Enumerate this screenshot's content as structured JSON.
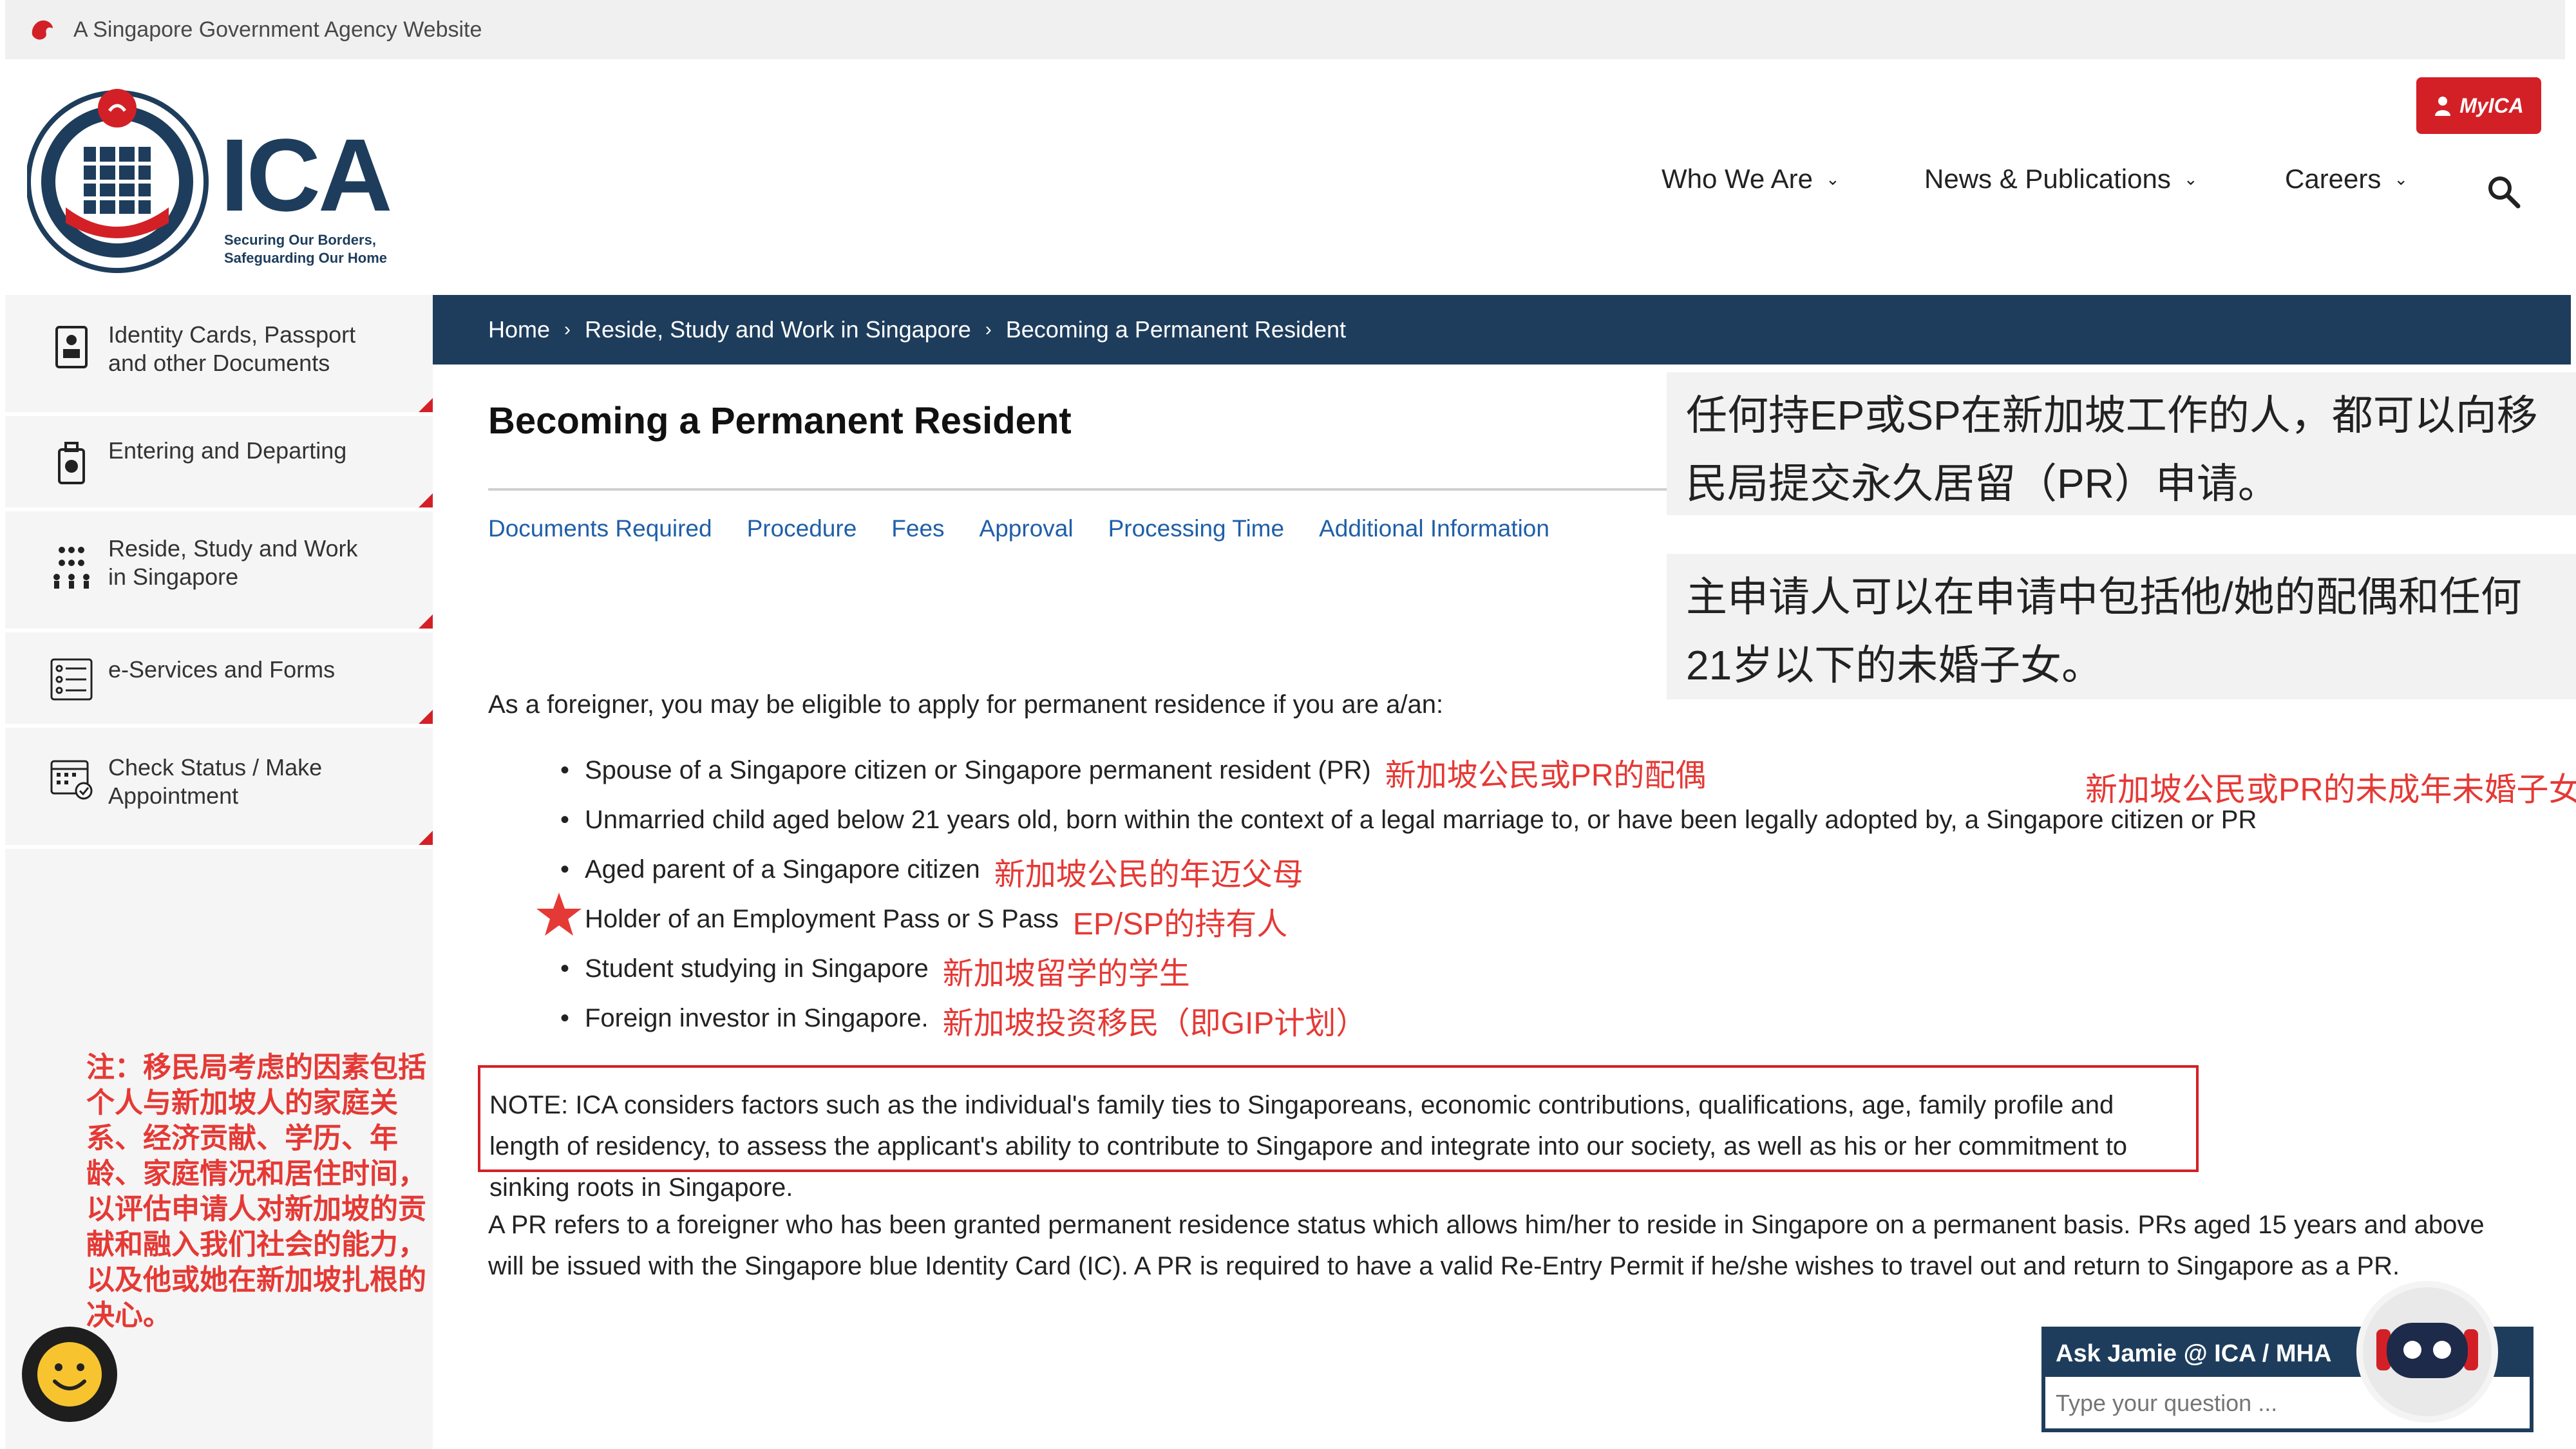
{
  "govbar": {
    "text": "A Singapore Government Agency Website"
  },
  "header": {
    "logo_text": "ICA",
    "logo_tagline_1": "Securing Our Borders,",
    "logo_tagline_2": "Safeguarding Our Home",
    "myica_label": "MyICA",
    "nav": [
      {
        "label": "Who We Are"
      },
      {
        "label": "News & Publications"
      },
      {
        "label": "Careers"
      }
    ]
  },
  "sidebar": {
    "items": [
      {
        "label_1": "Identity Cards, Passport",
        "label_2": "and other Documents",
        "icon": "id-card-icon"
      },
      {
        "label_1": "Entering and Departing",
        "label_2": "",
        "icon": "luggage-icon"
      },
      {
        "label_1": "Reside, Study and Work",
        "label_2": "in Singapore",
        "icon": "people-icon"
      },
      {
        "label_1": "e-Services and Forms",
        "label_2": "",
        "icon": "form-list-icon"
      },
      {
        "label_1": "Check Status / Make",
        "label_2": "Appointment",
        "icon": "calendar-check-icon"
      }
    ]
  },
  "breadcrumb": {
    "items": [
      "Home",
      "Reside, Study and Work in Singapore",
      "Becoming a Permanent Resident"
    ]
  },
  "main": {
    "title": "Becoming a Permanent Resident",
    "tabs": [
      "Documents Required",
      "Procedure",
      "Fees",
      "Approval",
      "Processing Time",
      "Additional Information"
    ],
    "intro": "As a foreigner, you may be eligible to apply for permanent residence if you are a/an:",
    "bullets": [
      {
        "text": "Spouse of a Singapore citizen or Singapore permanent resident (PR)",
        "zh": "新加坡公民或PR的配偶"
      },
      {
        "text": "Unmarried child aged below 21 years old, born within the context of a legal marriage to, or have been legally adopted by, a Singapore citizen or PR",
        "zh": ""
      },
      {
        "text": "Aged parent of a Singapore citizen",
        "zh": "新加坡公民的年迈父母"
      },
      {
        "text": "Holder of an Employment Pass or S Pass",
        "zh": "EP/SP的持有人"
      },
      {
        "text": "Student studying in Singapore",
        "zh": "新加坡留学的学生"
      },
      {
        "text": "Foreign investor in Singapore.",
        "zh": "新加坡投资移民（即GIP计划）"
      }
    ],
    "note": "NOTE: ICA considers factors such as the individual's family ties to Singaporeans, economic contributions, qualifications, age, family profile and length of residency, to assess the applicant's ability to contribute to Singapore and integrate into our society, as well as his or her commitment to sinking roots in Singapore.",
    "pr_paragraph": "A PR refers to a foreigner who has been granted permanent residence status which allows him/her to reside in Singapore on a permanent basis.  PRs aged 15 years and above will be issued with the Singapore blue Identity Card (IC). A PR is required to have a valid Re-Entry Permit if he/she wishes to travel out and return to Singapore as a PR."
  },
  "annotations": {
    "box1": "任何持EP或SP在新加坡工作的人，都可以向移民局提交永久居留（PR）申请。",
    "box2": "主申请人可以在申请中包括他/她的配偶和任何21岁以下的未婚子女。",
    "child_zh": "新加坡公民或PR的未成年未婚子女",
    "note_zh": "注：移民局考虑的因素包括个人与新加坡人的家庭关系、经济贡献、学历、年龄、家庭情况和居住时间，以评估申请人对新加坡的贡献和融入我们社会的能力，以及他或她在新加坡扎根的决心。"
  },
  "chat": {
    "title": "Ask Jamie @ ICA / MHA",
    "placeholder": "Type your question ..."
  },
  "colors": {
    "brand_red": "#d32027",
    "navy": "#1e3d5c",
    "link_blue": "#1f5fa8",
    "annotation_red": "#e53935"
  }
}
